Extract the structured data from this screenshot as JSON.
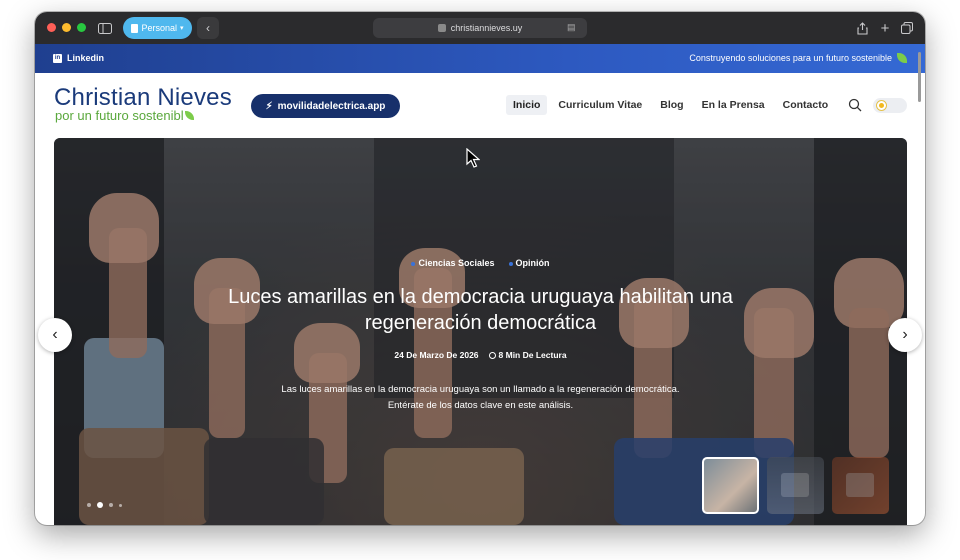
{
  "browser": {
    "profile_label": "Personal",
    "url": "christiannieves.uy"
  },
  "topbar": {
    "social_label": "Linkedin",
    "tagline": "Construyendo soluciones para un futuro sostenible"
  },
  "header": {
    "logo_name": "Christian Nieves",
    "logo_subtitle": "por un futuro sostenibl",
    "cta_label": "movilidadelectrica.app",
    "nav": [
      {
        "label": "Inicio",
        "active": true
      },
      {
        "label": "Curriculum Vitae",
        "active": false
      },
      {
        "label": "Blog",
        "active": false
      },
      {
        "label": "En la Prensa",
        "active": false
      },
      {
        "label": "Contacto",
        "active": false
      }
    ]
  },
  "hero": {
    "categories": [
      "Ciencias Sociales",
      "Opinión"
    ],
    "title": "Luces amarillas en la democracia uruguaya habilitan una regeneración democrática",
    "date": "24 De Marzo De 2026",
    "read_time": "8 Min De Lectura",
    "excerpt": "Las luces amarillas en la democracia uruguaya son un llamado a la regeneración democrática. Entérate de los datos clave en este análisis.",
    "slides_total": 4,
    "active_slide": 2
  },
  "colors": {
    "brand_navy": "#17306b",
    "brand_green": "#5aa83c",
    "topbar_blue": "#2d59c0"
  }
}
